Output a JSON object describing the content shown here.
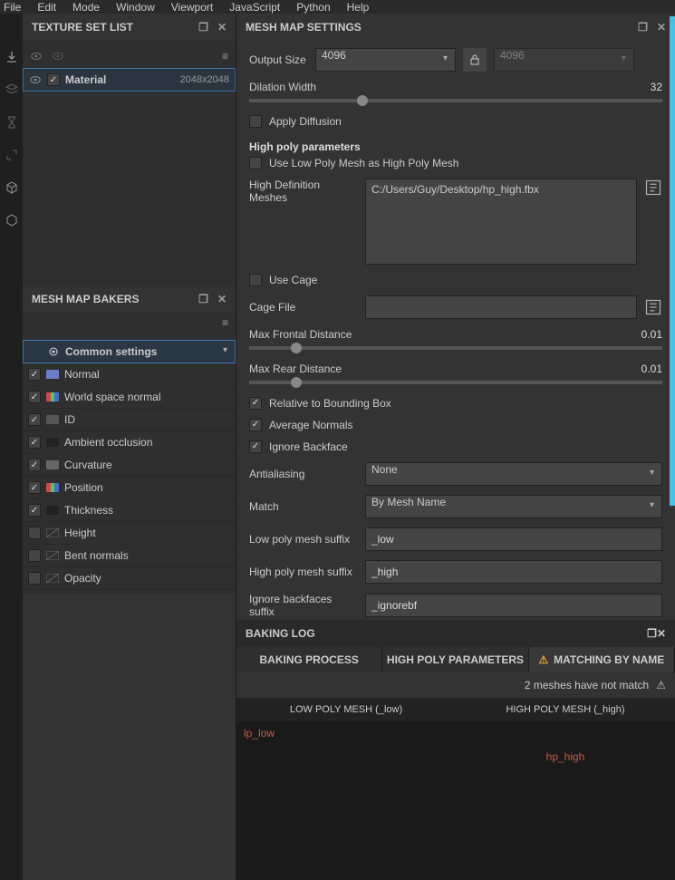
{
  "menu": [
    "File",
    "Edit",
    "Mode",
    "Window",
    "Viewport",
    "JavaScript",
    "Python",
    "Help"
  ],
  "panels": {
    "texture_set_list": {
      "title": "TEXTURE SET LIST"
    },
    "mesh_map_bakers": {
      "title": "MESH MAP BAKERS"
    },
    "mesh_map_settings": {
      "title": "MESH MAP SETTINGS"
    },
    "baking_log": {
      "title": "BAKING LOG"
    }
  },
  "texture_set": {
    "name": "Material",
    "resolution": "2048x2048"
  },
  "bakers": {
    "common": "Common settings",
    "items": [
      {
        "label": "Normal",
        "checked": true,
        "color": "#6b7dc9"
      },
      {
        "label": "World space normal",
        "checked": true,
        "color": "mix"
      },
      {
        "label": "ID",
        "checked": true,
        "color": "#555"
      },
      {
        "label": "Ambient occlusion",
        "checked": true,
        "color": "#222"
      },
      {
        "label": "Curvature",
        "checked": true,
        "color": "#666"
      },
      {
        "label": "Position",
        "checked": true,
        "color": "mix"
      },
      {
        "label": "Thickness",
        "checked": true,
        "color": "#222"
      },
      {
        "label": "Height",
        "checked": false,
        "color": "none"
      },
      {
        "label": "Bent normals",
        "checked": false,
        "color": "none"
      },
      {
        "label": "Opacity",
        "checked": false,
        "color": "none"
      }
    ]
  },
  "settings": {
    "output_size_label": "Output Size",
    "output_size": "4096",
    "output_size_locked": "4096",
    "dilation_label": "Dilation Width",
    "dilation_value": "32",
    "dilation_pct": 26,
    "apply_diffusion": "Apply Diffusion",
    "high_poly_title": "High poly parameters",
    "use_low_as_high": "Use Low Poly Mesh as High Poly Mesh",
    "hd_meshes_label": "High Definition Meshes",
    "hd_meshes_path": "C:/Users/Guy/Desktop/hp_high.fbx",
    "use_cage": "Use Cage",
    "cage_file_label": "Cage File",
    "max_frontal_label": "Max Frontal Distance",
    "max_frontal_value": "0.01",
    "max_frontal_pct": 10,
    "max_rear_label": "Max Rear Distance",
    "max_rear_value": "0.01",
    "max_rear_pct": 10,
    "relative_bb": "Relative to Bounding Box",
    "avg_normals": "Average Normals",
    "ignore_backface": "Ignore Backface",
    "aa_label": "Antialiasing",
    "aa_value": "None",
    "match_label": "Match",
    "match_value": "By Mesh Name",
    "low_suffix_label": "Low poly mesh suffix",
    "low_suffix": "_low",
    "high_suffix_label": "High poly mesh suffix",
    "high_suffix": "_high",
    "ignore_suffix_label": "Ignore backfaces suffix",
    "ignore_suffix": "_ignorebf"
  },
  "log": {
    "tabs": [
      "BAKING PROCESS",
      "HIGH POLY PARAMETERS",
      "MATCHING BY NAME"
    ],
    "warning": "2 meshes have not match",
    "cols": [
      "LOW POLY MESH (_low)",
      "HIGH POLY MESH (_high)"
    ],
    "rows": [
      [
        "lp_low",
        ""
      ],
      [
        "",
        "hp_high"
      ]
    ]
  }
}
